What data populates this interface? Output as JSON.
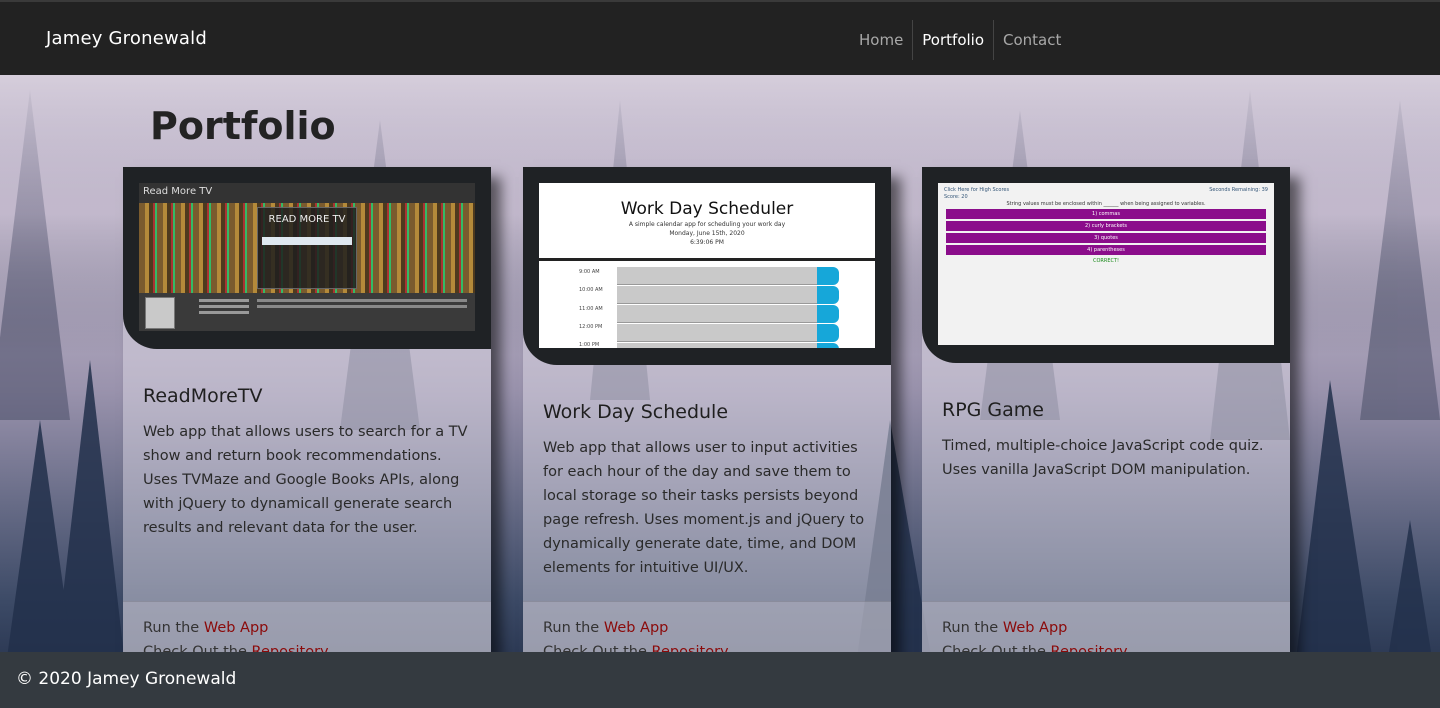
{
  "nav": {
    "brand": "Jamey Gronewald",
    "links": [
      {
        "label": "Home",
        "active": false
      },
      {
        "label": "Portfolio",
        "active": true
      },
      {
        "label": "Contact",
        "active": false
      }
    ]
  },
  "page": {
    "title": "Portfolio"
  },
  "cards": [
    {
      "title": "ReadMoreTV",
      "description": "Web app that allows users to search for a TV show and return book recommendations. Uses TVMaze and Google Books APIs, along with jQuery to dynamicall generate search results and relevant data for the user.",
      "run_prefix": "Run the ",
      "run_link": "Web App",
      "repo_prefix": "Check Out the ",
      "repo_link": "Repository",
      "screenshot": {
        "header": "Read More TV",
        "box_title": "READ MORE TV"
      }
    },
    {
      "title": "Work Day Schedule",
      "description": "Web app that allows user to input activities for each hour of the day and save them to local storage so their tasks persists beyond page refresh. Uses moment.js and jQuery to dynamically generate date, time, and DOM elements for intuitive UI/UX.",
      "run_prefix": "Run the ",
      "run_link": "Web App",
      "repo_prefix": "Check Out the ",
      "repo_link": "Repository",
      "screenshot": {
        "header": "Work Day Scheduler",
        "subtitle": "A simple calendar app for scheduling your work day",
        "date": "Monday, June 15th, 2020",
        "time": "6:39:06 PM",
        "hours": [
          "9:00 AM",
          "10:00 AM",
          "11:00 AM",
          "12:00 PM",
          "1:00 PM"
        ]
      }
    },
    {
      "title": "RPG Game",
      "description": "Timed, multiple-choice JavaScript code quiz. Uses vanilla JavaScript DOM manipulation.",
      "run_prefix": "Run the ",
      "run_link": "Web App",
      "repo_prefix": "Check Out the ",
      "repo_link": "Repository",
      "screenshot": {
        "header_left": "Click Here for High Scores",
        "header_right": "Seconds Remaining: 39",
        "score": "Score: 20",
        "question": "String values must be enclosed within ______ when being assigned to variables.",
        "options": [
          "1) commas",
          "2) curly brackets",
          "3) quotes",
          "4) parentheses"
        ],
        "result": "CORRECT!"
      }
    }
  ],
  "footer": {
    "text": "© 2020 Jamey Gronewald"
  }
}
